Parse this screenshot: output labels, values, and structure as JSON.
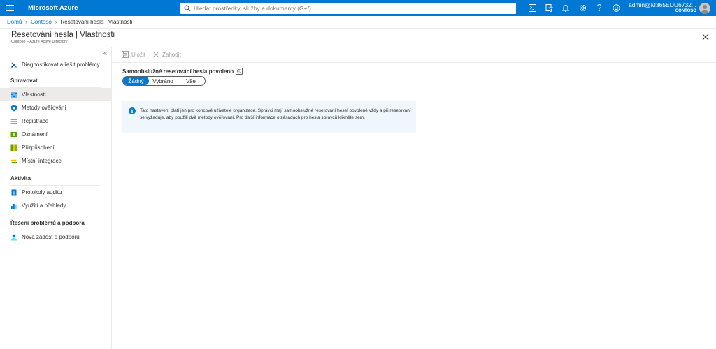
{
  "topbar": {
    "brand": "Microsoft Azure",
    "search_placeholder": "Hledat prostředky, služby a dokumenty (G+/)",
    "account_name": "admin@M365EDU6732...",
    "account_tenant": "CONTOSO"
  },
  "breadcrumb": {
    "home": "Domů",
    "contoso": "Contoso",
    "current": "Resetování hesla | Vlastnosti"
  },
  "header": {
    "title": "Resetování hesla | Vlastnosti",
    "subtitle": "Contoso – Azure Active Directory"
  },
  "sidebar": {
    "collapse": "«",
    "diagnose": "Diagnostikovat a řešit problémy",
    "manage_header": "Spravovat",
    "manage_items": [
      "Vlastnosti",
      "Metody ověřování",
      "Registrace",
      "Oznámení",
      "Přizpůsobení",
      "Místní integrace"
    ],
    "activity_header": "Aktivita",
    "activity_items": [
      "Protokoly auditu",
      "Využití a přehledy"
    ],
    "support_header": "Řešení problémů a podpora",
    "support_items": [
      "Nová žádost o podporu"
    ]
  },
  "toolbar": {
    "save": "Uložit",
    "discard": "Zahodit"
  },
  "field": {
    "label": "Samoobslužné resetování hesla povoleno",
    "options": [
      "Žádný",
      "Vybráno",
      "Vše"
    ],
    "selected": "Žádný"
  },
  "info": {
    "icon": "i",
    "text": "Tato nastavení platí jen pro koncové uživatele organizace. Správci mají samoobslužné resetování hesel povolené vždy a při resetování se vyžaduje, aby použili dvě metody ověřování. Pro další informace o zásadách pro hesla správců klikněte sem."
  },
  "colors": {
    "accent": "#0078d4",
    "info_bg": "#eff6fc",
    "selected_nav": "#edebe9"
  }
}
